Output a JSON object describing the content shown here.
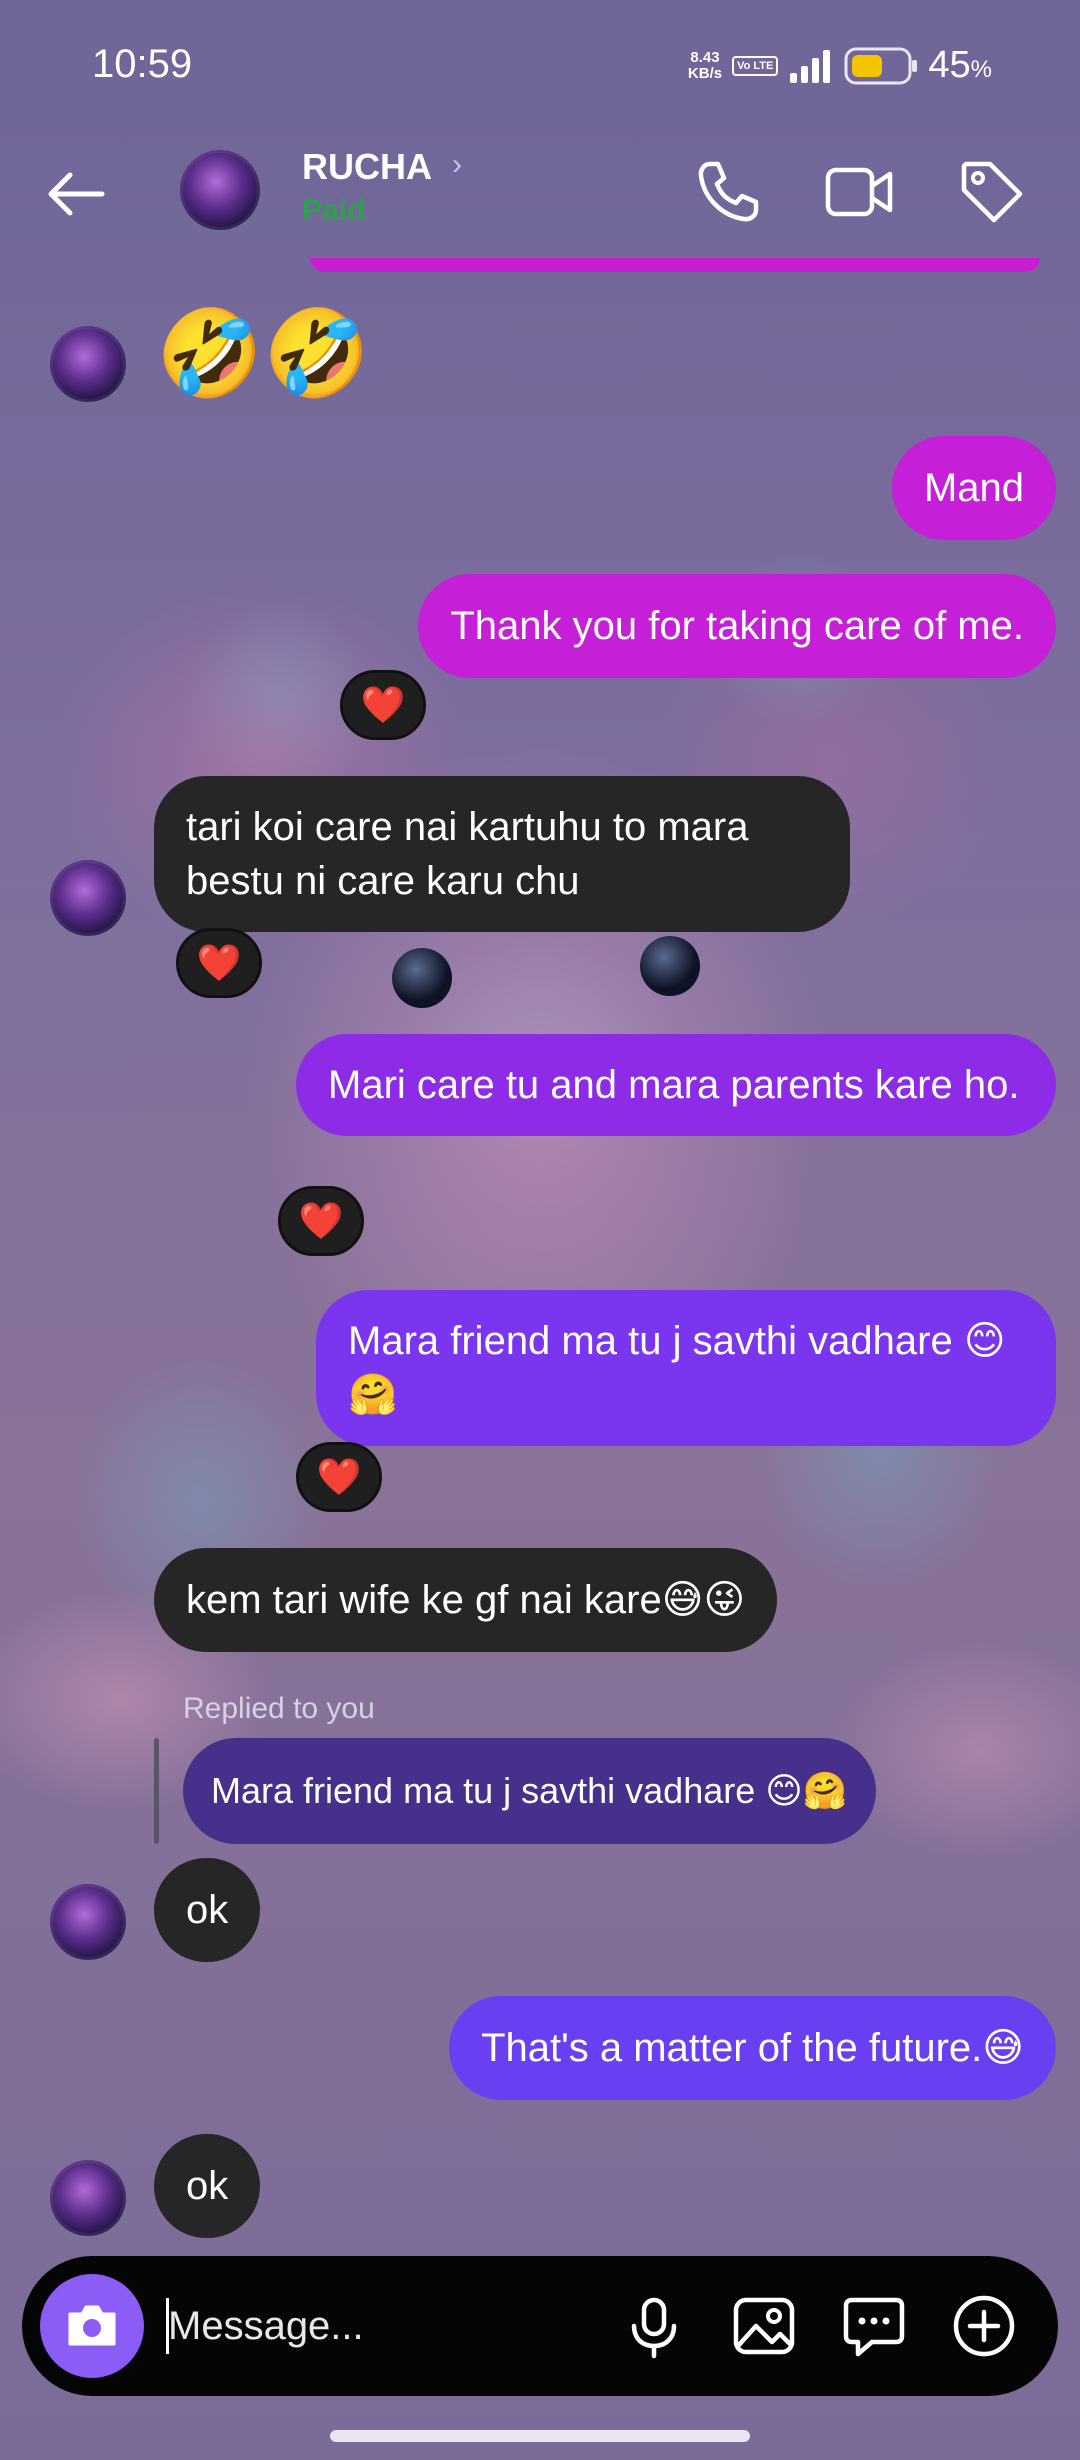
{
  "status_bar": {
    "time": "10:59",
    "net_speed_value": "8.43",
    "net_speed_unit": "KB/s",
    "volte": "Vo LTE",
    "battery": "45",
    "battery_unit": "%"
  },
  "header": {
    "contact_name": "RUCHA",
    "contact_status": "Paid",
    "status_color": "#2fa04e"
  },
  "messages": [
    {
      "id": 1,
      "direction": "incoming",
      "text": "🤣🤣"
    },
    {
      "id": 2,
      "direction": "outgoing",
      "text": "Mand"
    },
    {
      "id": 3,
      "direction": "outgoing",
      "text": "Thank you for taking care of me.",
      "reaction": "❤️"
    },
    {
      "id": 4,
      "direction": "incoming",
      "text": "tari koi care nai kartuhu to mara bestu ni care karu chu",
      "reaction": "❤️"
    },
    {
      "id": 5,
      "direction": "outgoing",
      "text": "Mari care tu and mara parents kare ho.",
      "reaction": "❤️"
    },
    {
      "id": 6,
      "direction": "outgoing",
      "text": "Mara friend ma tu j savthi vadhare 😊🤗",
      "reaction": "❤️"
    },
    {
      "id": 7,
      "direction": "incoming",
      "text": "kem tari wife ke gf nai kare😅😜"
    },
    {
      "id": 8,
      "direction": "incoming",
      "reply_label": "Replied to you",
      "quoted": "Mara friend ma tu j savthi vadhare 😊🤗",
      "text": "ok"
    },
    {
      "id": 9,
      "direction": "outgoing",
      "text": "That's a matter of the future.😅"
    },
    {
      "id": 10,
      "direction": "incoming",
      "text": "ok"
    }
  ],
  "composer": {
    "placeholder": "Message..."
  },
  "icons": {
    "back": "arrow-left-icon",
    "call": "phone-icon",
    "video": "video-camera-icon",
    "tag": "tag-icon",
    "camera": "camera-icon",
    "mic": "microphone-icon",
    "gallery": "image-icon",
    "sticker": "chat-bubble-icon",
    "plus": "plus-circle-icon"
  },
  "colors": {
    "incoming_bubble": "#262626",
    "outgoing_gradient": [
      "#c51fd8",
      "#8e2be6",
      "#7a35ee",
      "#6a3ff2"
    ],
    "camera_button": "#8b5cf6"
  }
}
